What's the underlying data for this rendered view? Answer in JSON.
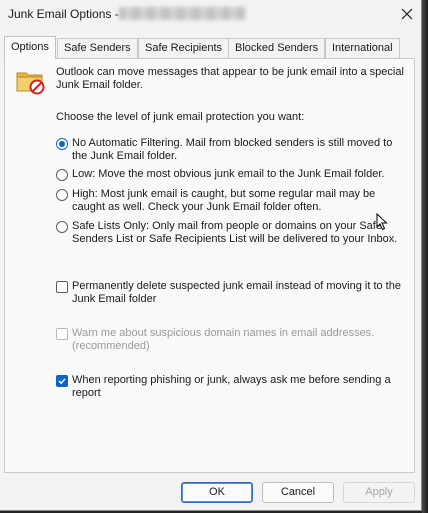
{
  "window": {
    "title": "Junk Email Options - ",
    "title_account_blurred": "(redacted email address)",
    "close_label": "Close"
  },
  "tabs": [
    {
      "label": "Options",
      "active": true
    },
    {
      "label": "Safe Senders",
      "active": false
    },
    {
      "label": "Safe Recipients",
      "active": false
    },
    {
      "label": "Blocked Senders",
      "active": false
    },
    {
      "label": "International",
      "active": false
    }
  ],
  "options_panel": {
    "intro_text": "Outlook can move messages that appear to be junk email into a special Junk Email folder.",
    "choose_label": "Choose the level of junk email protection you want:",
    "levels": [
      {
        "label": "No Automatic Filtering. Mail from blocked senders is still moved to the Junk Email folder.",
        "selected": true
      },
      {
        "label": "Low: Move the most obvious junk email to the Junk Email folder.",
        "selected": false
      },
      {
        "label": "High: Most junk email is caught, but some regular mail may be caught as well. Check your Junk Email folder often.",
        "selected": false
      },
      {
        "label": "Safe Lists Only: Only mail from people or domains on your Safe Senders List or Safe Recipients List will be delivered to your Inbox.",
        "selected": false
      }
    ],
    "checkboxes": [
      {
        "label": "Permanently delete suspected junk email instead of moving it to the Junk Email folder",
        "checked": false,
        "enabled": true
      },
      {
        "label": "Warn me about suspicious domain names in email addresses. (recommended)",
        "checked": false,
        "enabled": false
      },
      {
        "label": "When reporting phishing or junk, always ask me before sending a report",
        "checked": true,
        "enabled": true
      }
    ]
  },
  "buttons": {
    "ok": "OK",
    "cancel": "Cancel",
    "apply": "Apply",
    "apply_enabled": false
  },
  "colors": {
    "accent": "#0f63c4",
    "window_bg": "#f3f3f3",
    "panel_bg": "#f9f9f9"
  }
}
